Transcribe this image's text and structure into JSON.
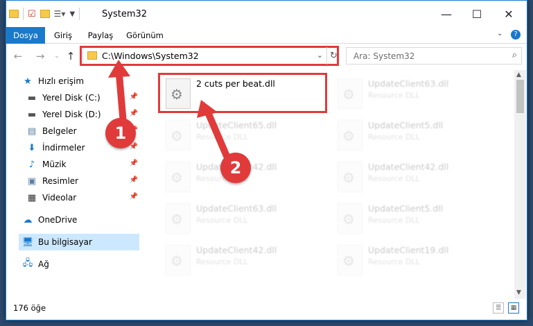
{
  "window": {
    "title": "System32"
  },
  "ribbon": {
    "tabs": [
      "Dosya",
      "Giriş",
      "Paylaş",
      "Görünüm"
    ]
  },
  "address": {
    "path": "C:\\Windows\\System32"
  },
  "search": {
    "placeholder": "Ara: System32"
  },
  "sidebar": {
    "items": [
      {
        "label": "Hızlı erişim",
        "icon": "star-icon"
      },
      {
        "label": "Yerel Disk (C:)",
        "icon": "drive-icon"
      },
      {
        "label": "Yerel Disk (D:)",
        "icon": "drive-icon"
      },
      {
        "label": "Belgeler",
        "icon": "documents-icon"
      },
      {
        "label": "İndirmeler",
        "icon": "download-icon"
      },
      {
        "label": "Müzik",
        "icon": "music-icon"
      },
      {
        "label": "Resimler",
        "icon": "pictures-icon"
      },
      {
        "label": "Videolar",
        "icon": "videos-icon"
      },
      {
        "label": "OneDrive",
        "icon": "cloud-icon"
      },
      {
        "label": "Bu bilgisayar",
        "icon": "computer-icon"
      },
      {
        "label": "Ağ",
        "icon": "network-icon"
      }
    ]
  },
  "files": [
    {
      "name": "2 cuts per beat.dll",
      "type": ""
    },
    {
      "name": "UpdateClient63.dll",
      "type": "Resource DLL"
    },
    {
      "name": "UpdateClient65.dll",
      "type": "Resource DLL"
    },
    {
      "name": "UpdateClient5.dll",
      "type": "Resource DLL"
    },
    {
      "name": "UpdateClient42.dll",
      "type": "Resource DLL"
    },
    {
      "name": "UpdateClient42.dll",
      "type": "Resource DLL"
    },
    {
      "name": "UpdateClient63.dll",
      "type": "Resource DLL"
    },
    {
      "name": "UpdateClient5.dll",
      "type": "Resource DLL"
    },
    {
      "name": "UpdateClient42.dll",
      "type": "Resource DLL"
    },
    {
      "name": "UpdateClient19.dll",
      "type": "Resource DLL"
    }
  ],
  "status": {
    "count": "176 öğe"
  },
  "annotations": {
    "step1": "1",
    "step2": "2",
    "color": "#e03a3a"
  }
}
